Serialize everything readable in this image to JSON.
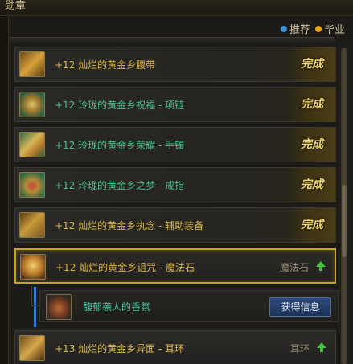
{
  "window": {
    "title": "勋章"
  },
  "legend": [
    {
      "label": "推荐",
      "color": "#3f8fe0"
    },
    {
      "label": "毕业",
      "color": "#e8a020"
    }
  ],
  "items": [
    {
      "name": "+12 灿烂的黄金乡腰带",
      "status": "完成",
      "icon": "belt-icon"
    },
    {
      "name": "+12 玲珑的黄金乡祝福 - 项链",
      "status": "完成",
      "icon": "necklace-icon"
    },
    {
      "name": "+12 玲珑的黄金乡荣耀 - 手镯",
      "status": "完成",
      "icon": "bracelet-icon"
    },
    {
      "name": "+12 玲珑的黄金乡之梦 - 戒指",
      "status": "完成",
      "icon": "ring-icon"
    },
    {
      "name": "+12 灿烂的黄金乡执念 - 辅助装备",
      "status": "完成",
      "icon": "support-gear-icon"
    },
    {
      "name": "+12 灿烂的黄金乡诅咒 - 魔法石",
      "slot": "魔法石",
      "icon": "magic-stone-icon"
    },
    {
      "name": "+13 灿烂的黄金乡异面 - 耳环",
      "slot": "耳环",
      "icon": "earring-icon"
    }
  ],
  "sub_item": {
    "name": "馥郁袭人的香氛",
    "button": "获得信息",
    "icon": "perfume-icon"
  },
  "colors": {
    "accent_gold": "#c9a028",
    "done_text": "#f2d670",
    "upgrade_green": "#45c23e",
    "button_blue": "#2d4a7a"
  }
}
